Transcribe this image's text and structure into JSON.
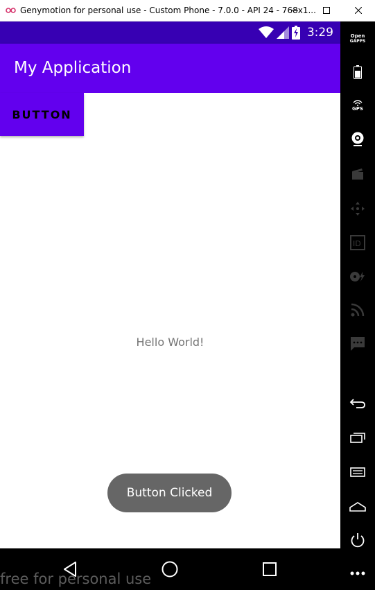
{
  "window": {
    "title": "Genymotion for personal use - Custom Phone - 7.0.0 - API 24 - 768x1..."
  },
  "statusbar": {
    "time": "3:29",
    "bg_color": "#3700b3"
  },
  "appbar": {
    "title": "My Application",
    "bg_color": "#6200ee"
  },
  "content": {
    "button_label": "BUTTON",
    "text": "Hello World!",
    "toast": "Button Clicked"
  },
  "navbar": {
    "back_icon": "back-triangle-icon",
    "home_icon": "home-circle-icon",
    "recent_icon": "recent-square-icon"
  },
  "watermark": "free for personal use",
  "toolbar": {
    "opengapps_line1": "Open",
    "opengapps_line2": "GAPPS",
    "gps_label": "GPS",
    "items": [
      "opengapps-icon",
      "battery-icon",
      "gps-icon",
      "webcam-icon",
      "capture-icon",
      "remote-control-icon",
      "identifiers-icon",
      "disk-io-icon",
      "network-icon",
      "sms-icon",
      "back-icon",
      "recent-apps-icon",
      "menu-icon",
      "home-icon",
      "power-icon",
      "more-icon"
    ]
  }
}
